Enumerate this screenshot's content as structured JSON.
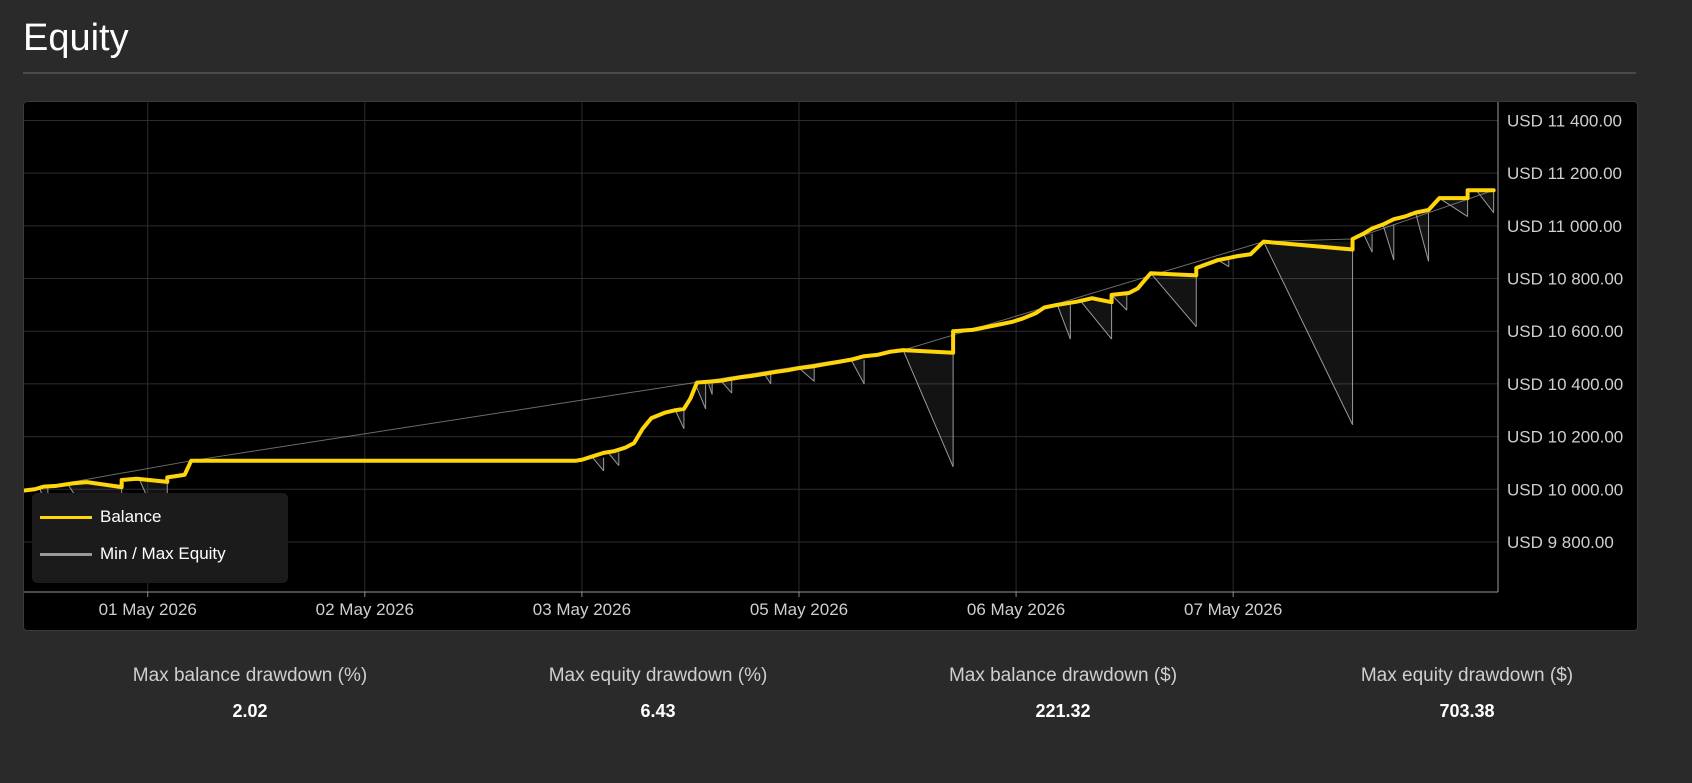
{
  "page": {
    "title": "Equity"
  },
  "legend": {
    "items": [
      {
        "label": "Balance",
        "color": "#ffd60a"
      },
      {
        "label": "Min / Max Equity",
        "color": "#9a9a9a"
      }
    ]
  },
  "stats": [
    {
      "label": "Max balance drawdown (%)",
      "value": "2.02"
    },
    {
      "label": "Max equity drawdown (%)",
      "value": "6.43"
    },
    {
      "label": "Max balance drawdown ($)",
      "value": "221.32"
    },
    {
      "label": "Max equity drawdown ($)",
      "value": "703.38"
    }
  ],
  "chart_data": {
    "type": "line",
    "title": "Equity",
    "xlabel": "",
    "ylabel": "",
    "ylim": [
      9610,
      11470
    ],
    "y_ticks": [
      9800,
      10000,
      10200,
      10400,
      10600,
      10800,
      11000,
      11200,
      11400
    ],
    "y_tick_labels": [
      "USD 9 800.00",
      "USD 10 000.00",
      "USD 10 200.00",
      "USD 10 400.00",
      "USD 10 600.00",
      "USD 10 800.00",
      "USD 11 000.00",
      "USD 11 200.00",
      "USD 11 400.00"
    ],
    "x_ticks": [
      1,
      2,
      3,
      4,
      5,
      6
    ],
    "x_tick_labels": [
      "01 May 2026",
      "02 May 2026",
      "03 May 2026",
      "05 May 2026",
      "06 May 2026",
      "07 May 2026"
    ],
    "xlim": [
      0.43,
      7.22
    ],
    "grid": true,
    "legend_position": "bottom-left",
    "series": [
      {
        "name": "Balance",
        "color": "#ffd60a",
        "points": [
          [
            0.43,
            9995
          ],
          [
            0.48,
            10000
          ],
          [
            0.52,
            10010
          ],
          [
            0.58,
            10013
          ],
          [
            0.62,
            10018
          ],
          [
            0.66,
            10023
          ],
          [
            0.72,
            10027
          ],
          [
            0.88,
            10008
          ],
          [
            0.88,
            10035
          ],
          [
            0.92,
            10038
          ],
          [
            0.95,
            10040
          ],
          [
            1.09,
            10028
          ],
          [
            1.09,
            10045
          ],
          [
            1.13,
            10050
          ],
          [
            1.17,
            10055
          ],
          [
            1.2,
            10108
          ],
          [
            2.97,
            10108
          ],
          [
            3.0,
            10112
          ],
          [
            3.05,
            10125
          ],
          [
            3.1,
            10138
          ],
          [
            3.15,
            10145
          ],
          [
            3.2,
            10158
          ],
          [
            3.24,
            10175
          ],
          [
            3.28,
            10230
          ],
          [
            3.32,
            10270
          ],
          [
            3.38,
            10290
          ],
          [
            3.43,
            10300
          ],
          [
            3.47,
            10305
          ],
          [
            3.5,
            10345
          ],
          [
            3.53,
            10405
          ],
          [
            3.58,
            10408
          ],
          [
            3.64,
            10412
          ],
          [
            3.68,
            10418
          ],
          [
            3.73,
            10425
          ],
          [
            3.78,
            10430
          ],
          [
            3.84,
            10438
          ],
          [
            3.89,
            10445
          ],
          [
            3.95,
            10452
          ],
          [
            4.0,
            10460
          ],
          [
            4.06,
            10466
          ],
          [
            4.12,
            10475
          ],
          [
            4.18,
            10483
          ],
          [
            4.24,
            10492
          ],
          [
            4.3,
            10505
          ],
          [
            4.36,
            10510
          ],
          [
            4.42,
            10522
          ],
          [
            4.48,
            10528
          ],
          [
            4.71,
            10518
          ],
          [
            4.71,
            10600
          ],
          [
            4.8,
            10605
          ],
          [
            4.86,
            10615
          ],
          [
            4.92,
            10625
          ],
          [
            4.98,
            10635
          ],
          [
            5.03,
            10648
          ],
          [
            5.09,
            10668
          ],
          [
            5.13,
            10690
          ],
          [
            5.19,
            10700
          ],
          [
            5.28,
            10712
          ],
          [
            5.35,
            10725
          ],
          [
            5.44,
            10710
          ],
          [
            5.44,
            10738
          ],
          [
            5.52,
            10745
          ],
          [
            5.56,
            10762
          ],
          [
            5.62,
            10820
          ],
          [
            5.83,
            10812
          ],
          [
            5.83,
            10840
          ],
          [
            5.88,
            10855
          ],
          [
            5.93,
            10870
          ],
          [
            5.98,
            10878
          ],
          [
            6.02,
            10885
          ],
          [
            6.08,
            10892
          ],
          [
            6.14,
            10940
          ],
          [
            6.55,
            10910
          ],
          [
            6.55,
            10950
          ],
          [
            6.6,
            10970
          ],
          [
            6.64,
            10990
          ],
          [
            6.69,
            11005
          ],
          [
            6.74,
            11025
          ],
          [
            6.79,
            11035
          ],
          [
            6.84,
            11050
          ],
          [
            6.9,
            11060
          ],
          [
            6.95,
            11105
          ],
          [
            7.08,
            11105
          ],
          [
            7.08,
            11135
          ],
          [
            7.2,
            11135
          ]
        ]
      },
      {
        "name": "Min / Max Equity",
        "color": "#9a9a9a",
        "segments": [
          [
            0.5,
            10008,
            0.54,
            9920
          ],
          [
            0.63,
            10022,
            0.88,
            9700
          ],
          [
            0.96,
            10040,
            1.09,
            9800
          ],
          [
            3.05,
            10120,
            3.1,
            10070
          ],
          [
            3.12,
            10140,
            3.17,
            10090
          ],
          [
            3.43,
            10300,
            3.47,
            10230
          ],
          [
            3.52,
            10405,
            3.57,
            10305
          ],
          [
            3.58,
            10408,
            3.6,
            10360
          ],
          [
            3.64,
            10412,
            3.69,
            10365
          ],
          [
            3.84,
            10438,
            3.87,
            10400
          ],
          [
            4.0,
            10460,
            4.07,
            10410
          ],
          [
            4.24,
            10492,
            4.3,
            10400
          ],
          [
            4.48,
            10528,
            4.71,
            10085
          ],
          [
            5.19,
            10700,
            5.25,
            10570
          ],
          [
            5.3,
            10712,
            5.44,
            10570
          ],
          [
            5.44,
            10738,
            5.51,
            10680
          ],
          [
            5.62,
            10820,
            5.83,
            10617
          ],
          [
            5.93,
            10870,
            5.98,
            10845
          ],
          [
            6.14,
            10940,
            6.55,
            10245
          ],
          [
            6.6,
            10970,
            6.64,
            10900
          ],
          [
            6.69,
            11005,
            6.74,
            10870
          ],
          [
            6.84,
            11050,
            6.9,
            10865
          ],
          [
            6.95,
            11105,
            7.08,
            11035
          ],
          [
            7.12,
            11135,
            7.2,
            11050
          ]
        ],
        "upper_line": [
          [
            0.43,
            9995
          ],
          [
            1.2,
            10108
          ],
          [
            4.48,
            10528
          ],
          [
            6.14,
            10940
          ],
          [
            6.55,
            10950
          ],
          [
            7.2,
            11135
          ]
        ]
      }
    ]
  }
}
